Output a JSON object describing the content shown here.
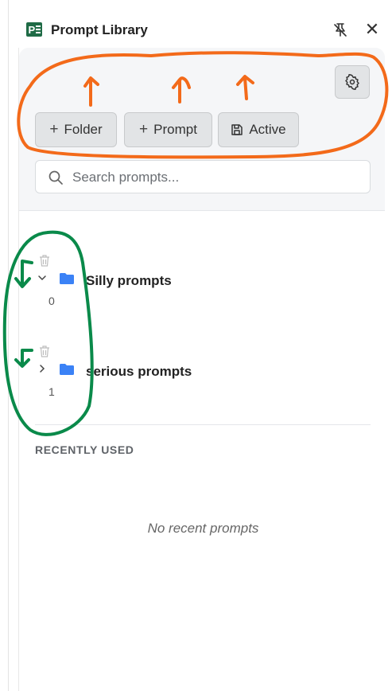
{
  "header": {
    "title": "Prompt Library",
    "close_symbol": "✕",
    "icons": [
      "app-logo-icon",
      "pin-off-icon",
      "close-icon"
    ]
  },
  "toolbar": {
    "settings_icon": "gear-icon",
    "buttons": [
      {
        "plus": "+",
        "label": "Folder",
        "icon": "plus-icon"
      },
      {
        "plus": "+",
        "label": "Prompt",
        "icon": "plus-icon"
      },
      {
        "label": "Active",
        "icon": "save-icon"
      }
    ]
  },
  "search": {
    "placeholder": "Search prompts...",
    "value": ""
  },
  "folders": [
    {
      "name": "Silly prompts",
      "count": "0",
      "expanded": true
    },
    {
      "name": "serious prompts",
      "count": "1",
      "expanded": false
    }
  ],
  "recent": {
    "title": "RECENTLY USED",
    "empty_message": "No recent prompts"
  },
  "colors": {
    "accent_folder": "#3b82f6",
    "annotation_orange": "#f36a1a",
    "annotation_green": "#0a8a4a",
    "card_bg": "#f5f6f8",
    "button_bg": "#e2e4e6"
  }
}
